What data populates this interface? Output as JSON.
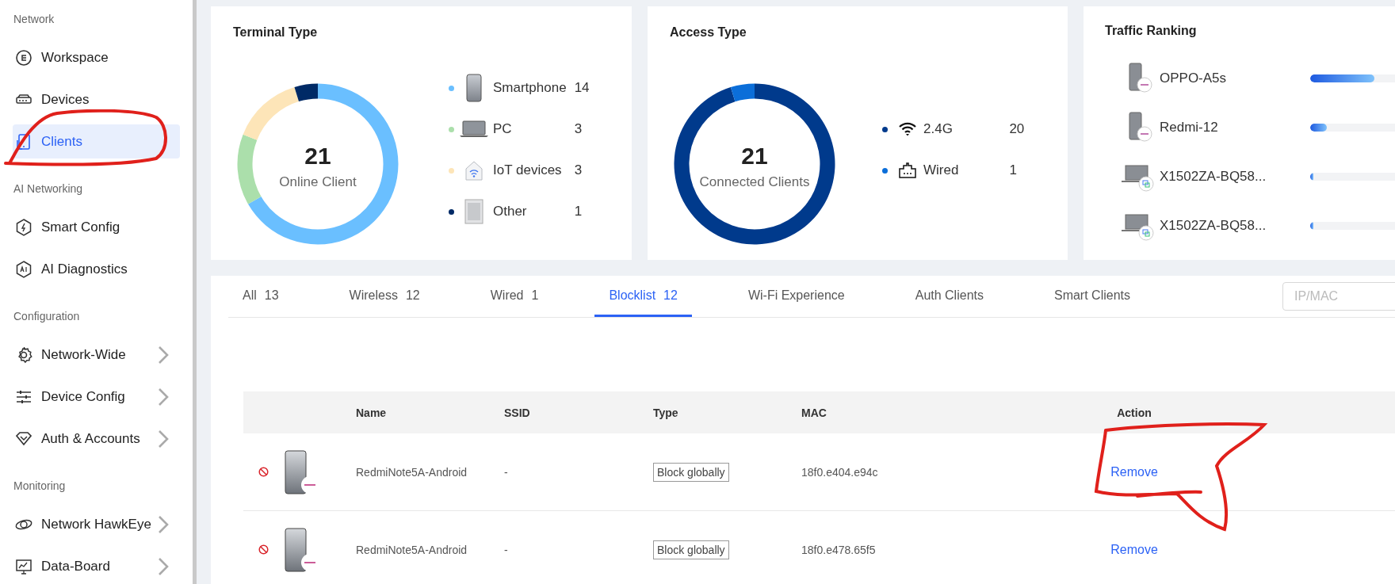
{
  "sidebar": {
    "sections": [
      {
        "heading": "Network",
        "items": [
          {
            "label": "Workspace",
            "kind": "workspace",
            "selected": false,
            "has_submenu": false
          },
          {
            "label": "Devices",
            "kind": "devices",
            "selected": false,
            "has_submenu": false
          },
          {
            "label": "Clients",
            "kind": "clients",
            "selected": true,
            "has_submenu": false
          }
        ]
      },
      {
        "heading": "AI Networking",
        "items": [
          {
            "label": "Smart Config",
            "kind": "smart",
            "selected": false,
            "has_submenu": false
          },
          {
            "label": "AI Diagnostics",
            "kind": "ai",
            "selected": false,
            "has_submenu": false
          }
        ]
      },
      {
        "heading": "Configuration",
        "items": [
          {
            "label": "Network-Wide",
            "kind": "gear",
            "selected": false,
            "has_submenu": true
          },
          {
            "label": "Device Config",
            "kind": "sliders",
            "selected": false,
            "has_submenu": true
          },
          {
            "label": "Auth & Accounts",
            "kind": "shield",
            "selected": false,
            "has_submenu": true
          }
        ]
      },
      {
        "heading": "Monitoring",
        "items": [
          {
            "label": "Network HawkEye",
            "kind": "eye",
            "selected": false,
            "has_submenu": true
          },
          {
            "label": "Data-Board",
            "kind": "board",
            "selected": false,
            "has_submenu": true
          }
        ]
      }
    ]
  },
  "terminal_type": {
    "title": "Terminal Type",
    "center_value": "21",
    "center_label": "Online Client",
    "legend": [
      {
        "count": "14",
        "color": "#6abfff",
        "kind": "phone"
      },
      {
        "count": "3",
        "color": "#abdfab",
        "kind": "laptop"
      },
      {
        "count": "3",
        "color": "#fde5b8",
        "kind": "iot"
      },
      {
        "count": "1",
        "color": "#002a66",
        "kind": "other"
      }
    ],
    "chart_data": {
      "type": "donut",
      "categories": [
        "Smartphone",
        "PC",
        "IoT devices",
        "Other"
      ],
      "values": [
        66.7,
        14.3,
        14.3,
        4.7
      ]
    }
  },
  "access_type": {
    "title": "Access Type",
    "center_value": "21",
    "center_label": "Connected Clients",
    "legend": [
      {
        "count": "20",
        "color": "#003a8c",
        "kind": "wifi"
      },
      {
        "count": "1",
        "color": "#0b6ed9",
        "kind": "wired"
      }
    ],
    "chart_data": {
      "type": "donut",
      "categories": [
        "2.4G",
        "Wired"
      ],
      "values": [
        95.2,
        4.8
      ]
    }
  },
  "traffic_ranking": {
    "title": "Traffic Ranking",
    "items": [
      {
        "name": "OPPO-A5s",
        "kind": "phone",
        "level": 0.66
      },
      {
        "name": "Redmi-12",
        "kind": "phone",
        "level": 0.17
      },
      {
        "name": "X1502ZA-BQ58...",
        "kind": "laptop",
        "level": 0.03
      },
      {
        "name": "X1502ZA-BQ58...",
        "kind": "laptop",
        "level": 0.03
      }
    ]
  },
  "clients": {
    "tabs": [
      {
        "label": "All",
        "count": "13",
        "selected": false
      },
      {
        "label": "Wireless",
        "count": "12",
        "selected": false
      },
      {
        "label": "Wired",
        "count": "1",
        "selected": false
      },
      {
        "label": "Blocklist",
        "count": "12",
        "selected": true
      },
      {
        "label": "Wi-Fi Experience",
        "selected": false
      },
      {
        "label": "Auth Clients",
        "selected": false
      },
      {
        "label": "Smart Clients",
        "selected": false
      }
    ],
    "search": {
      "placeholder": "IP/MAC"
    },
    "table": {
      "columns": [
        "Name",
        "SSID",
        "Type",
        "MAC",
        "Action"
      ],
      "rows": [
        {
          "name": "RedmiNote5A-Android",
          "ssid": "-",
          "type": "Block globally",
          "mac": "18f0.e404.e94c",
          "action": "Remove"
        },
        {
          "name": "RedmiNote5A-Android",
          "ssid": "-",
          "type": "Block globally",
          "mac": "18f0.e478.65f5",
          "action": "Remove"
        }
      ]
    }
  }
}
